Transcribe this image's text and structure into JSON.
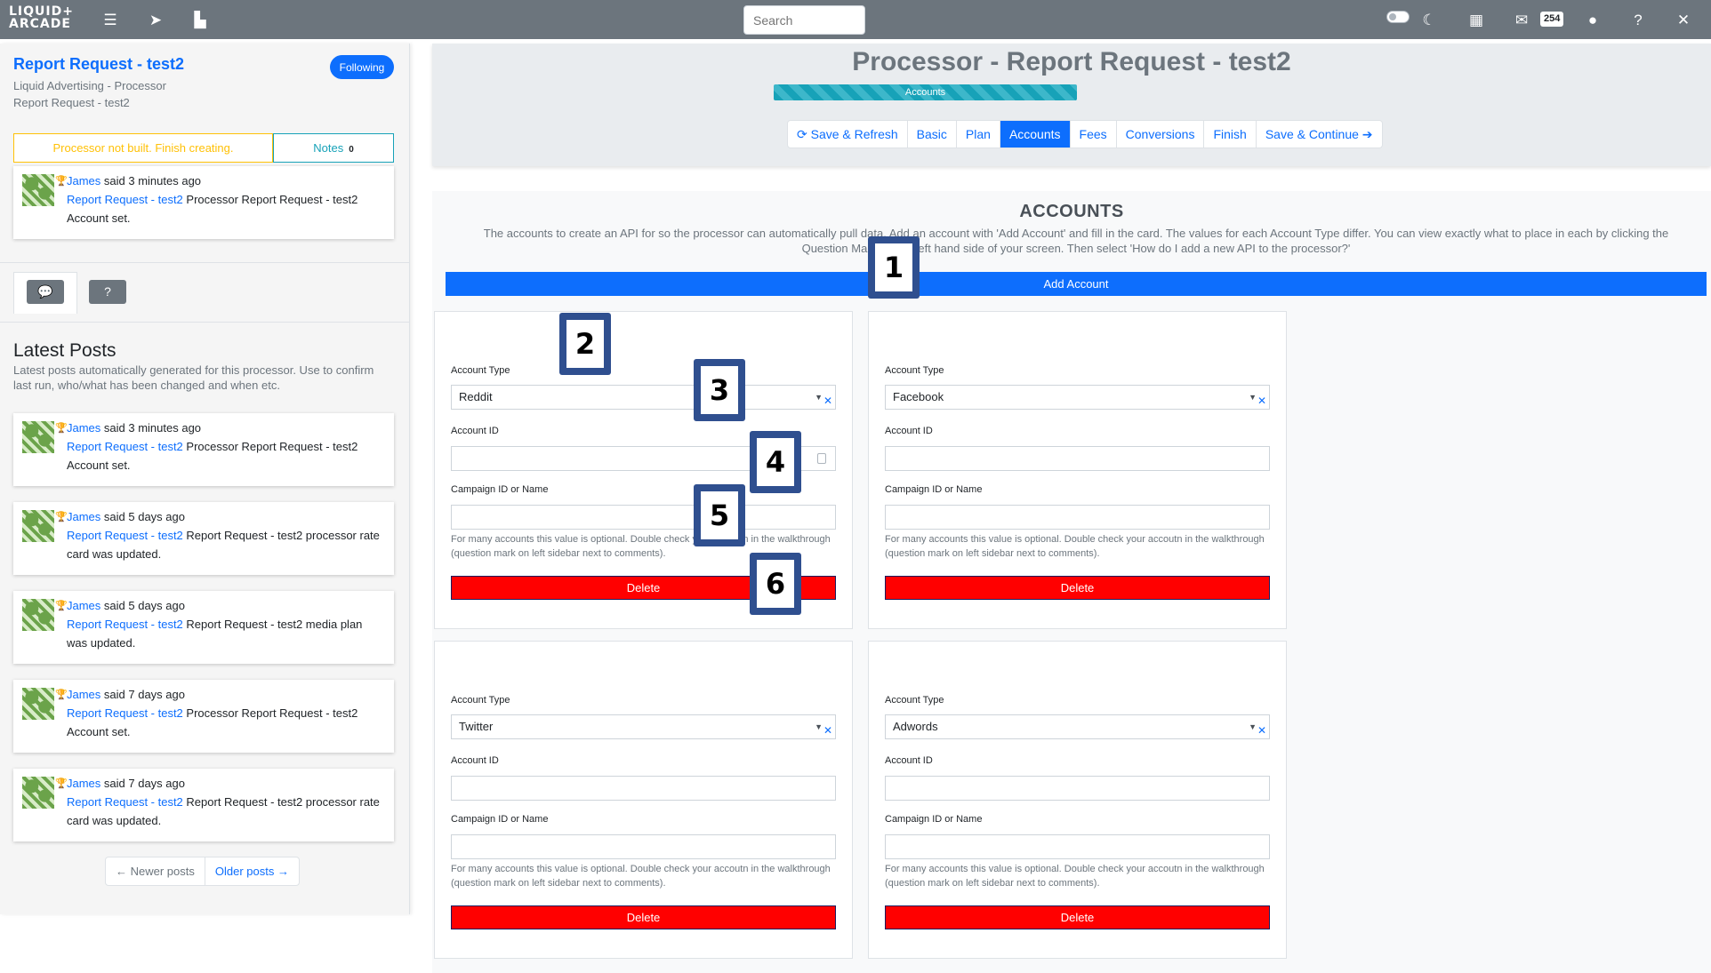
{
  "navbar": {
    "logo": "LIQUID+\nARCADE",
    "search_placeholder": "Search",
    "notification_count": "254",
    "icons": [
      "menu-icon",
      "send-icon",
      "chart-icon",
      "toggle-switch",
      "moon-icon",
      "calendar-icon",
      "mail-icon",
      "user-icon",
      "help-icon",
      "close-icon"
    ]
  },
  "sidebar": {
    "title": "Report Request - test2",
    "subtitle_1": "Liquid Advertising - Processor",
    "subtitle_2": "Report Request - test2",
    "follow_label": "Following",
    "warning": "Processor not built. Finish creating.",
    "notes_label": "Notes",
    "notes_count": "0",
    "top_post": {
      "name": "James",
      "time": " said 3 minutes ago",
      "link": "Report Request - test2",
      "text": " Processor Report Request - test2 Account set."
    },
    "latest_title": "Latest Posts",
    "latest_desc": "Latest posts automatically generated for this processor. Use to confirm last run, who/what has been changed and when etc.",
    "posts": [
      {
        "name": "James",
        "time": " said 3 minutes ago",
        "link": "Report Request - test2",
        "text": " Processor Report Request - test2 Account set."
      },
      {
        "name": "James",
        "time": " said 5 days ago",
        "link": "Report Request - test2",
        "text": " Report Request - test2 processor rate card was updated."
      },
      {
        "name": "James",
        "time": " said 5 days ago",
        "link": "Report Request - test2",
        "text": " Report Request - test2 media plan was updated."
      },
      {
        "name": "James",
        "time": " said 7 days ago",
        "link": "Report Request - test2",
        "text": " Processor Report Request - test2 Account set."
      },
      {
        "name": "James",
        "time": " said 7 days ago",
        "link": "Report Request - test2",
        "text": " Report Request - test2 processor rate card was updated."
      }
    ],
    "pager": {
      "newer": "← Newer posts",
      "older": "Older posts →"
    }
  },
  "main": {
    "title": "Processor - Report Request - test2",
    "progress_label": "Accounts",
    "progress_value": 1.0,
    "steps": [
      "⟳ Save & Refresh",
      "Basic",
      "Plan",
      "Accounts",
      "Fees",
      "Conversions",
      "Finish",
      "Save & Continue ➔"
    ],
    "active_step": "Accounts"
  },
  "accounts": {
    "title": "ACCOUNTS",
    "description": "The accounts to create an API for so the processor can automatically pull data. Add an account with 'Add Account' and fill in the card. The values for each Account Type differ. You can view exactly what to place in each by clicking the Question Mark on the left hand side of your screen. Then select 'How do I add a new API to the processor?'",
    "add_label": "Add Account",
    "type_label": "Account Type",
    "id_label": "Account ID",
    "campaign_label": "Campaign ID or Name",
    "help_text": "For many accounts this value is optional. Double check your accoutn in the walkthrough (question mark on left sidebar next to comments).",
    "delete_label": "Delete",
    "cards": [
      {
        "type": "Reddit"
      },
      {
        "type": "Facebook"
      },
      {
        "type": "Twitter"
      },
      {
        "type": "Adwords"
      }
    ]
  },
  "markers": [
    "1",
    "2",
    "3",
    "4",
    "5",
    "6"
  ],
  "colors": {
    "primary": "#0d6efd",
    "danger": "#ff0000",
    "warning": "#ffc107",
    "info": "#17a2b8",
    "marker": "#2f4f8f"
  }
}
